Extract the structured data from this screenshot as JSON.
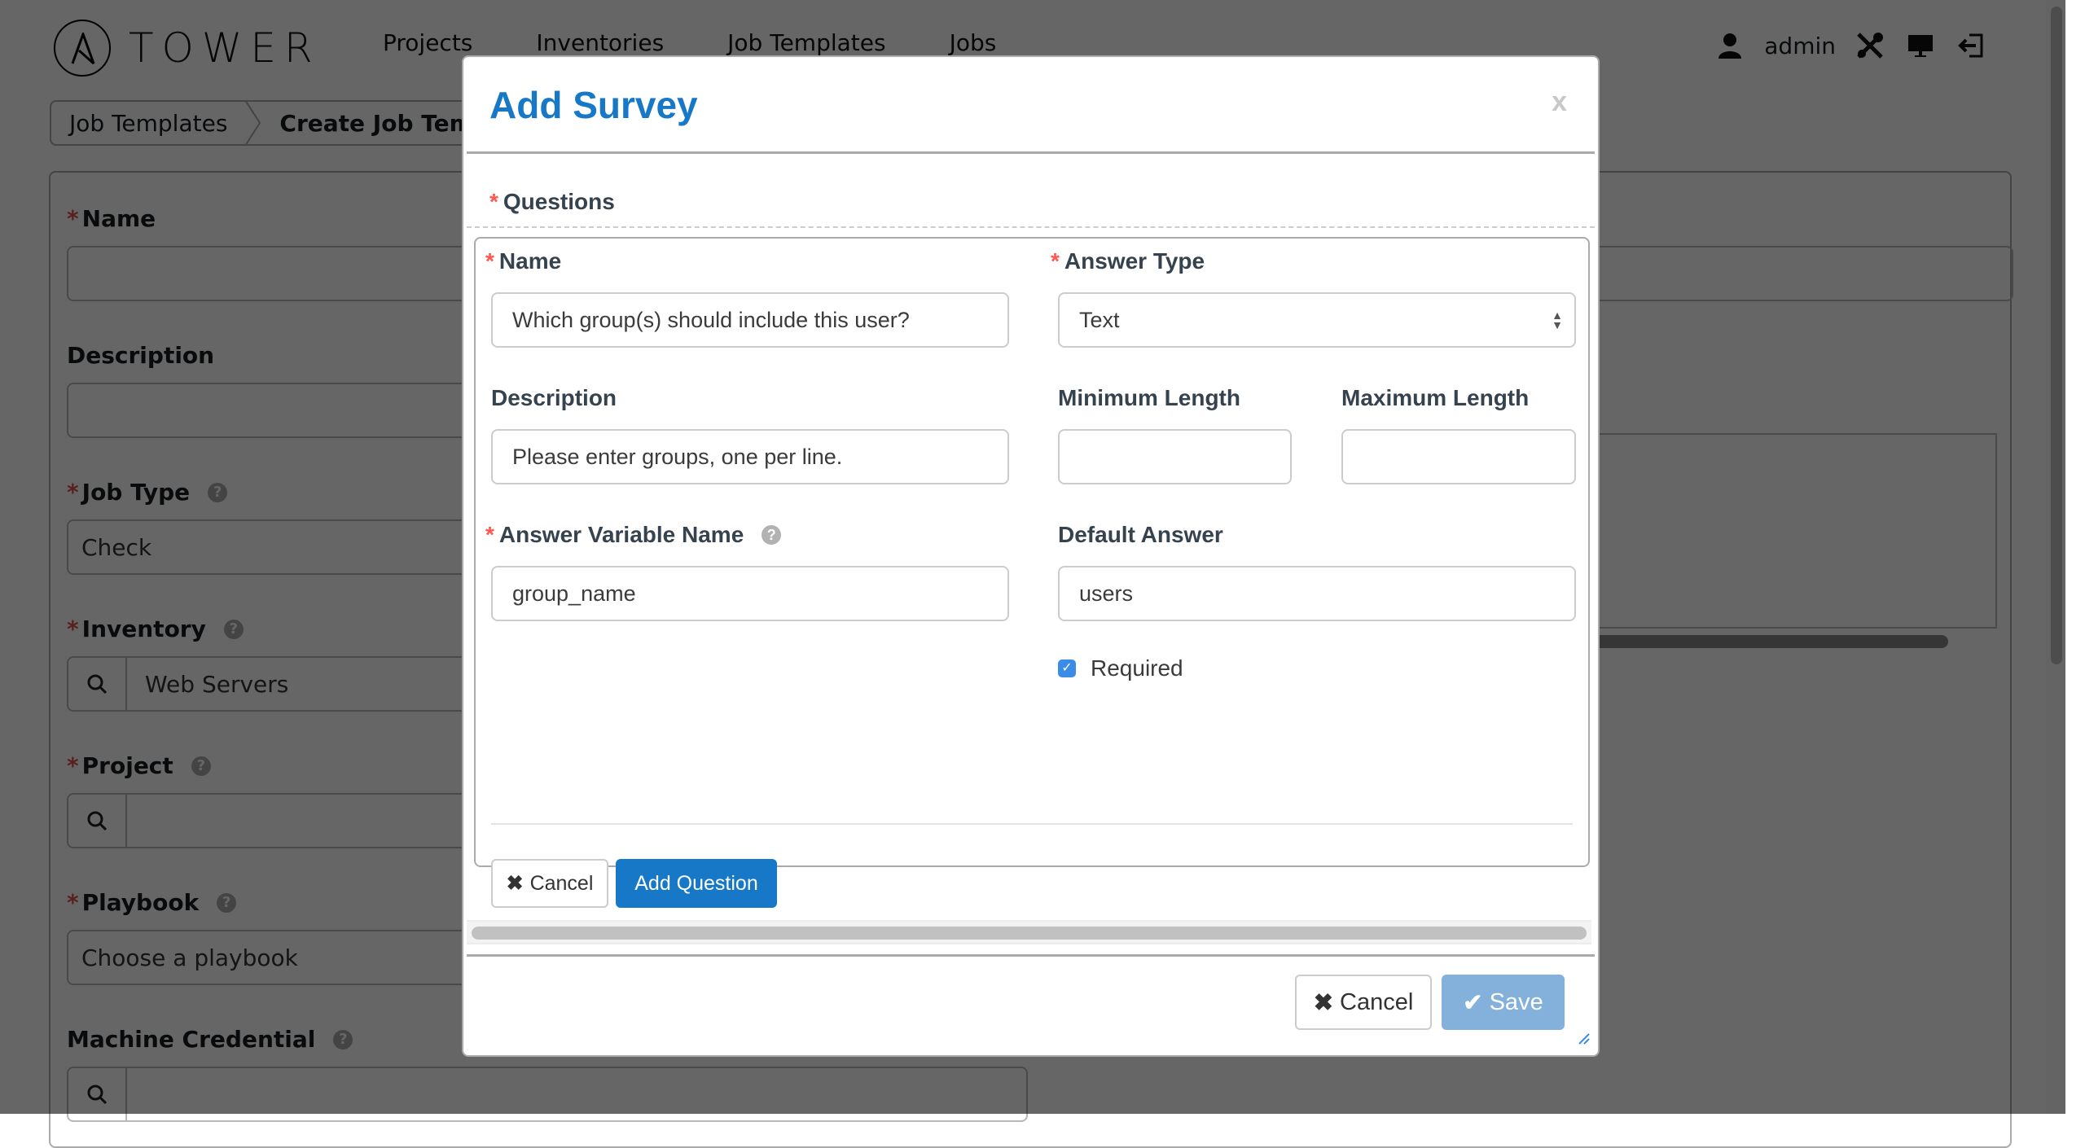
{
  "app": {
    "brand": "TOWER",
    "nav": [
      "Projects",
      "Inventories",
      "Job Templates",
      "Jobs"
    ],
    "user": "admin",
    "icons": {
      "user": "user-icon",
      "setup": "tools-icon",
      "monitor": "monitor-icon",
      "logout": "logout-icon"
    }
  },
  "breadcrumb": [
    "Job Templates",
    "Create Job Template"
  ],
  "form": {
    "fields": [
      {
        "label": "Name",
        "required": true,
        "help": false,
        "value": "",
        "lookup": false
      },
      {
        "label": "Description",
        "required": false,
        "help": false,
        "value": "",
        "lookup": false
      },
      {
        "label": "Job Type",
        "required": true,
        "help": true,
        "value": "Check",
        "lookup": false
      },
      {
        "label": "Inventory",
        "required": true,
        "help": true,
        "value": "Web Servers",
        "lookup": true
      },
      {
        "label": "Project",
        "required": true,
        "help": true,
        "value": "",
        "lookup": true
      },
      {
        "label": "Playbook",
        "required": true,
        "help": true,
        "value": "Choose a playbook",
        "lookup": false
      },
      {
        "label": "Machine Credential",
        "required": false,
        "help": true,
        "value": "",
        "lookup": true
      }
    ]
  },
  "modal": {
    "title": "Add Survey",
    "close": "x",
    "section_label": "Questions",
    "question": {
      "name_label": "Name",
      "name_value": "Which group(s) should include this user?",
      "answer_type_label": "Answer Type",
      "answer_type_value": "Text",
      "description_label": "Description",
      "description_value": "Please enter groups, one per line.",
      "min_length_label": "Minimum Length",
      "min_length_value": "",
      "max_length_label": "Maximum Length",
      "max_length_value": "",
      "variable_label": "Answer Variable Name",
      "variable_value": "group_name",
      "default_label": "Default Answer",
      "default_value": "users",
      "required_label": "Required",
      "required_checked": true,
      "cancel_label": "Cancel",
      "add_label": "Add Question"
    },
    "footer": {
      "cancel_label": "Cancel",
      "save_label": "Save"
    }
  },
  "colors": {
    "accent": "#1778c7",
    "required": "#ff5850",
    "save_disabled": "#83b1db",
    "overlay": "rgba(0,0,0,0.6)"
  }
}
